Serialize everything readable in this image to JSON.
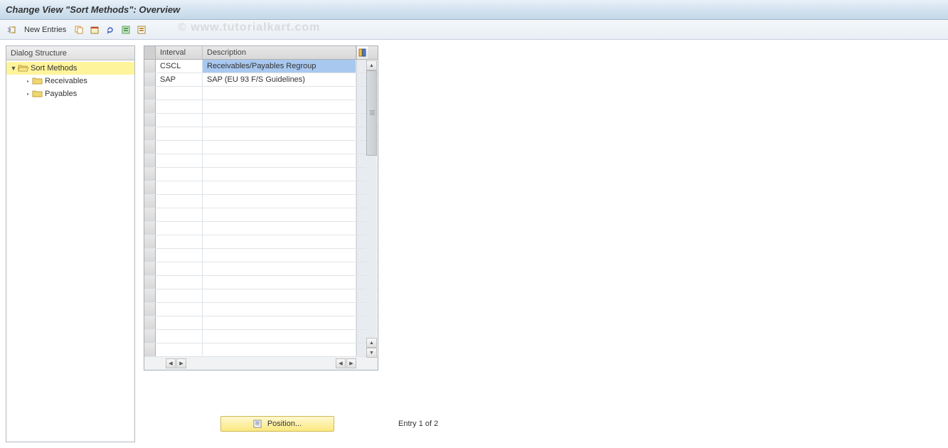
{
  "window": {
    "title": "Change View \"Sort Methods\": Overview"
  },
  "toolbar": {
    "new_entries": "New Entries"
  },
  "watermark": "© www.tutorialkart.com",
  "sidebar": {
    "header": "Dialog Structure",
    "root": {
      "label": "Sort Methods",
      "children": [
        {
          "label": "Receivables"
        },
        {
          "label": "Payables"
        }
      ]
    }
  },
  "table": {
    "columns": {
      "interval": "Interval",
      "description": "Description"
    },
    "rows": [
      {
        "interval": "CSCL",
        "description": "Receivables/Payables Regroup",
        "highlighted": true
      },
      {
        "interval": "SAP",
        "description": "SAP (EU 93 F/S Guidelines)",
        "highlighted": false
      }
    ],
    "empty_rows": 20
  },
  "footer": {
    "position_label": "Position...",
    "entry_status": "Entry 1 of 2"
  }
}
